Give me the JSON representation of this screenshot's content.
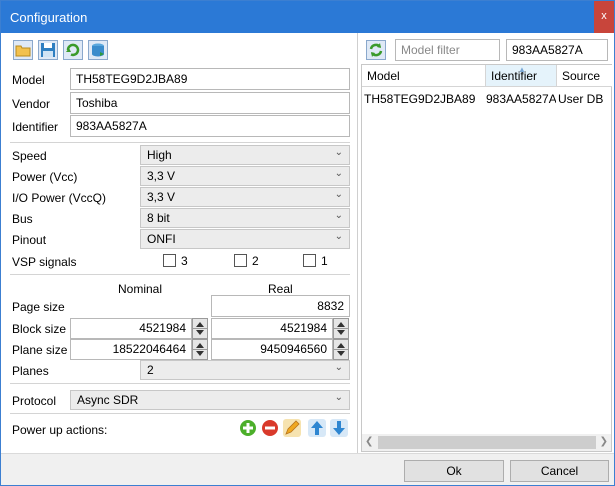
{
  "window": {
    "title": "Configuration",
    "close_label": "x"
  },
  "toolbar": {
    "icons": [
      "open-folder-icon",
      "save-disk-icon",
      "reload-icon",
      "database-icon"
    ]
  },
  "fields": {
    "model": {
      "label": "Model",
      "value": "TH58TEG9D2JBA89"
    },
    "vendor": {
      "label": "Vendor",
      "value": "Toshiba"
    },
    "identifier": {
      "label": "Identifier",
      "value": "983AA5827A"
    }
  },
  "settings": {
    "speed": {
      "label": "Speed",
      "value": "High"
    },
    "power_vcc": {
      "label": "Power (Vcc)",
      "value": "3,3 V"
    },
    "io_power": {
      "label": "I/O Power (VccQ)",
      "value": "3,3 V"
    },
    "bus": {
      "label": "Bus",
      "value": "8 bit"
    },
    "pinout": {
      "label": "Pinout",
      "value": "ONFI"
    }
  },
  "vsp": {
    "label": "VSP signals",
    "options": [
      {
        "label": "3",
        "checked": false
      },
      {
        "label": "2",
        "checked": false
      },
      {
        "label": "1",
        "checked": false
      }
    ]
  },
  "geometry": {
    "nominal_header": "Nominal",
    "real_header": "Real",
    "page_size": {
      "label": "Page size",
      "real": "8832"
    },
    "block_size": {
      "label": "Block size",
      "nominal": "4521984",
      "real": "4521984"
    },
    "plane_size": {
      "label": "Plane size",
      "nominal": "18522046464",
      "real": "9450946560"
    },
    "planes": {
      "label": "Planes",
      "value": "2"
    }
  },
  "protocol": {
    "label": "Protocol",
    "value": "Async SDR"
  },
  "power_up": {
    "label": "Power up actions:",
    "icons": [
      "add-icon",
      "remove-icon",
      "edit-icon",
      "move-up-icon",
      "move-down-icon"
    ]
  },
  "filter": {
    "model_placeholder": "Model filter",
    "identifier_value": "983AA5827A"
  },
  "table": {
    "columns": [
      "Model",
      "Identifier",
      "Source"
    ],
    "rows": [
      {
        "model": "TH58TEG9D2JBA89",
        "identifier": "983AA5827A",
        "source": "User DB"
      }
    ]
  },
  "buttons": {
    "ok": "Ok",
    "cancel": "Cancel"
  },
  "colors": {
    "titlebar": "#2b79d6",
    "close": "#c8453b",
    "accent_green": "#4caf2a",
    "accent_red": "#d93a2b"
  }
}
